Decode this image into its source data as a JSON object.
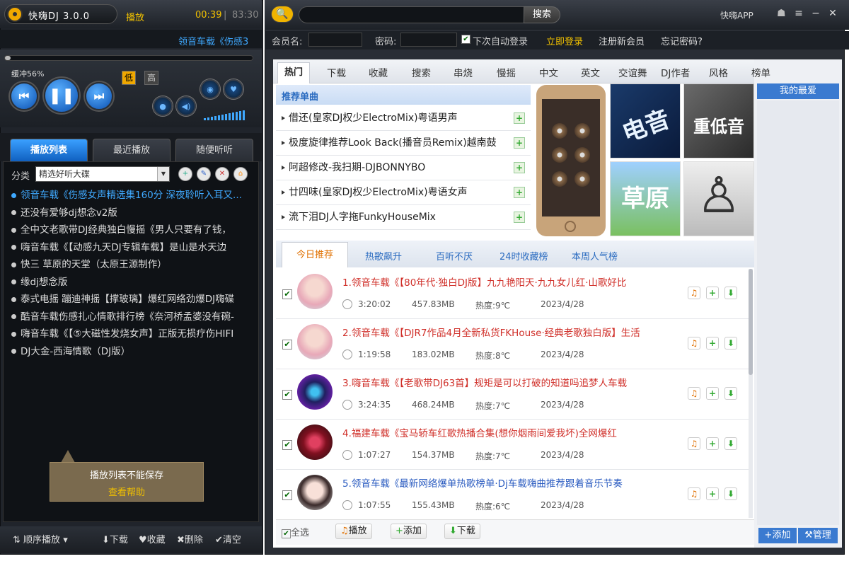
{
  "player": {
    "app_name": "快嗨DJ 3.0.0",
    "status": "播放",
    "time_current": "00:39",
    "time_separator": "|",
    "time_total": "83:30",
    "now_playing": "领音车载《伤感3",
    "progress": 0.008,
    "buffer_label": "缓冲56%",
    "quality_low": "低",
    "quality_high": "高",
    "accent_color": "#3fa9ff"
  },
  "left_tabs": [
    "播放列表",
    "最近播放",
    "随便听听"
  ],
  "category": {
    "label": "分类",
    "selected": "精选好听大碟"
  },
  "playlist": [
    "领音车载《伤感女声精选集160分 深夜聆听入耳又...",
    "还没有爱够dj想念v2版",
    "全中文老歌带DJ经典独白慢摇《男人只要有了钱，",
    "嗨音车载《【动感九天DJ专辑车载】是山是水天边",
    "快三  草原的天堂（太原王源制作）",
    "缘dj想念版",
    "泰式电摇 蹦迪神摇【撑玻璃】爆红网络劲爆DJ嗨碟",
    "酷音车载伤感扎心情歌排行榜《奈河桥孟婆没有碗-",
    "嗨音车载《【⑤大磁性发烧女声】正版无损疗伤HIFI",
    "DJ大金-西海情歌（DJ版）"
  ],
  "tip": {
    "text": "播放列表不能保存",
    "link": "查看帮助"
  },
  "left_bottom": {
    "order": "顺序播放",
    "download": "下载",
    "favorite": "收藏",
    "delete": "删除",
    "clear": "清空"
  },
  "search": {
    "placeholder": "",
    "button": "搜索"
  },
  "top_links": {
    "app": "快嗨APP"
  },
  "login": {
    "member_label": "会员名:",
    "password_label": "密码:",
    "auto_login": "下次自动登录",
    "login_button": "立即登录",
    "register": "注册新会员",
    "forgot": "忘记密码?"
  },
  "nav_tabs": [
    "热门",
    "下载",
    "收藏",
    "搜索",
    "串烧",
    "慢摇",
    "中文",
    "英文",
    "交谊舞",
    "DJ作者",
    "风格",
    "榜单"
  ],
  "recommend": {
    "title": "推荐单曲",
    "items": [
      "借还(皇家DJ权少ElectroMix)粤语男声",
      "极度旋律推荐Look Back(播音员Remix)越南鼓",
      "阿超修改-我扫期-DJBONNYBO",
      "廿四味(皇家DJ权少ElectroMix)粤语女声",
      "流下泪DJ人字拖FunkyHouseMix"
    ]
  },
  "albums": [
    {
      "text": "电音",
      "color": "#e8f4ff"
    },
    {
      "text": "重低音",
      "color": "#ffffff"
    },
    {
      "text": "草原",
      "color": "#ffffff"
    },
    {
      "text": "",
      "color": "#333333"
    }
  ],
  "sub_tabs": [
    "今日推荐",
    "热歌飙升",
    "百听不厌",
    "24时收藏榜",
    "本周人气榜"
  ],
  "songs": [
    {
      "title": "1.领音车载《【80年代·独白DJ版】九九艳阳天·九九女儿红·山歌好比",
      "duration": "3:20:02",
      "size": "457.83MB",
      "heat": "热度:9℃",
      "date": "2023/4/28",
      "color": "#d0302a"
    },
    {
      "title": "2.领音车载《【DJR7作品4月全新私货FKHouse·经典老歌独白版】生活",
      "duration": "1:19:58",
      "size": "183.02MB",
      "heat": "热度:8℃",
      "date": "2023/4/28",
      "color": "#d0302a"
    },
    {
      "title": "3.嗨音车载《【老歌带DJ63首】规矩是可以打破的知道吗追梦人车载",
      "duration": "3:24:35",
      "size": "468.24MB",
      "heat": "热度:7℃",
      "date": "2023/4/28",
      "color": "#d0302a"
    },
    {
      "title": "4.福建车载《宝马轿车红歌热播合集(想你烟雨间爱我坏)全网爆红",
      "duration": "1:07:27",
      "size": "154.37MB",
      "heat": "热度:7℃",
      "date": "2023/4/28",
      "color": "#d0302a"
    },
    {
      "title": "5.领音车载《最新网络爆单热歌榜单·Dj车载嗨曲推荐跟着音乐节奏",
      "duration": "1:07:55",
      "size": "155.43MB",
      "heat": "热度:6℃",
      "date": "2023/4/28",
      "color": "#2a5bc0"
    }
  ],
  "bottom": {
    "select_all": "全选",
    "play": "播放",
    "add": "添加",
    "download": "下载"
  },
  "favorites": {
    "title": "我的最爱",
    "add": "添加",
    "manage": "管理"
  }
}
